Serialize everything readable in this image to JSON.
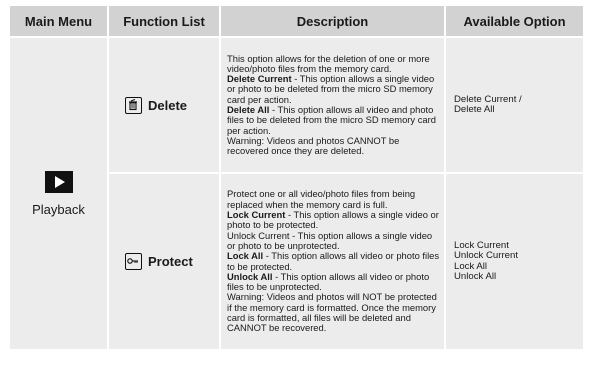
{
  "headers": {
    "main_menu": "Main Menu",
    "function_list": "Function List",
    "description": "Description",
    "available_option": "Available Option"
  },
  "main_menu_item": {
    "label": "Playback",
    "icon": "play-icon"
  },
  "rows": [
    {
      "function": "Delete",
      "icon": "trash-icon",
      "description": {
        "intro": "This option allows for the deletion of one or more video/photo files from the memory card.",
        "items": [
          {
            "term": "Delete Current",
            "text": " - This option allows a single video or photo to be deleted from the micro SD memory card per action."
          },
          {
            "term": "Delete All",
            "text": " - This option allows all video and photo files to be deleted from the micro SD memory card per action."
          }
        ],
        "warning": "Warning: Videos and photos CANNOT be recovered once they are deleted."
      },
      "options": [
        "Delete Current /",
        "Delete All"
      ]
    },
    {
      "function": "Protect",
      "icon": "key-icon",
      "description": {
        "intro": "Protect one or all video/photo files from being replaced when the  memory card is full.",
        "items": [
          {
            "term": "Lock Current",
            "text": " - This option allows a single video or photo to be protected."
          },
          {
            "term": "",
            "text": "Unlock Current - This option allows a single video or photo to be unprotected."
          },
          {
            "term": "Lock All",
            "text": " - This option allows all video or photo files to be protected."
          },
          {
            "term": "Unlock All",
            "text": " - This option allows all video or photo files to be unprotected."
          }
        ],
        "warning": "Warning: Videos and photos will NOT be protected if the memory card is formatted. Once the memory card is formatted, all files will be deleted and CANNOT be recovered."
      },
      "options": [
        "Lock Current",
        "Unlock Current",
        "Lock All",
        "Unlock All"
      ]
    }
  ]
}
